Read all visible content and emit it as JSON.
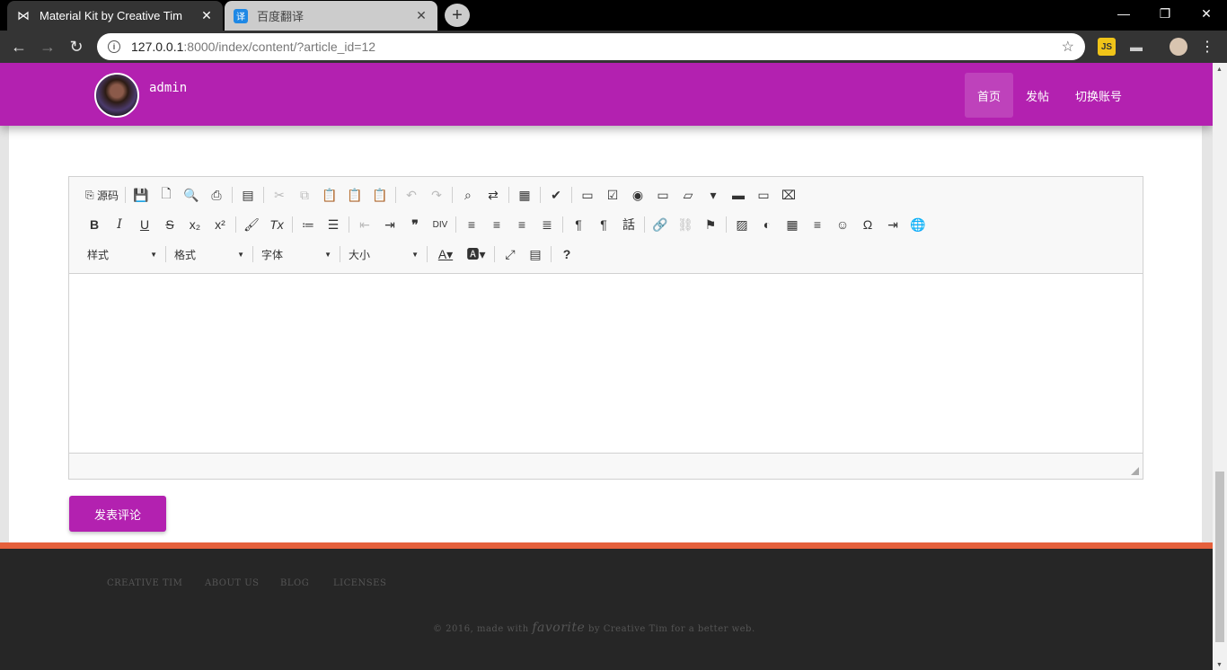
{
  "browser": {
    "tabs": [
      {
        "title": "Material Kit by Creative Tim",
        "icon": "bowtie-icon",
        "active": true
      },
      {
        "title": "百度翻译",
        "icon": "translate-icon",
        "favicon_text": "译",
        "active": false
      }
    ],
    "url_host": "127.0.0.1",
    "url_path": ":8000/index/content/?article_id=12",
    "ext_js_label": "JS"
  },
  "navbar": {
    "username": "admin",
    "links": [
      "首页",
      "发帖",
      "切换账号"
    ],
    "active_link": "首页",
    "color": "#b321b0"
  },
  "editor": {
    "row1": {
      "source_label": "源码"
    },
    "combos": {
      "style": "样式",
      "format": "格式",
      "font": "字体",
      "size": "大小"
    }
  },
  "submit_label": "发表评论",
  "footer": {
    "links": [
      "CREATIVE TIM",
      "ABOUT US",
      "BLOG",
      "LICENSES"
    ],
    "copy_prefix": "© 2016, made with",
    "copy_fav": "favorite",
    "copy_suffix": "by Creative Tim for a better web."
  },
  "colors": {
    "accent": "#b321b0",
    "orange": "#e5603c",
    "footer_bg": "#262626"
  }
}
